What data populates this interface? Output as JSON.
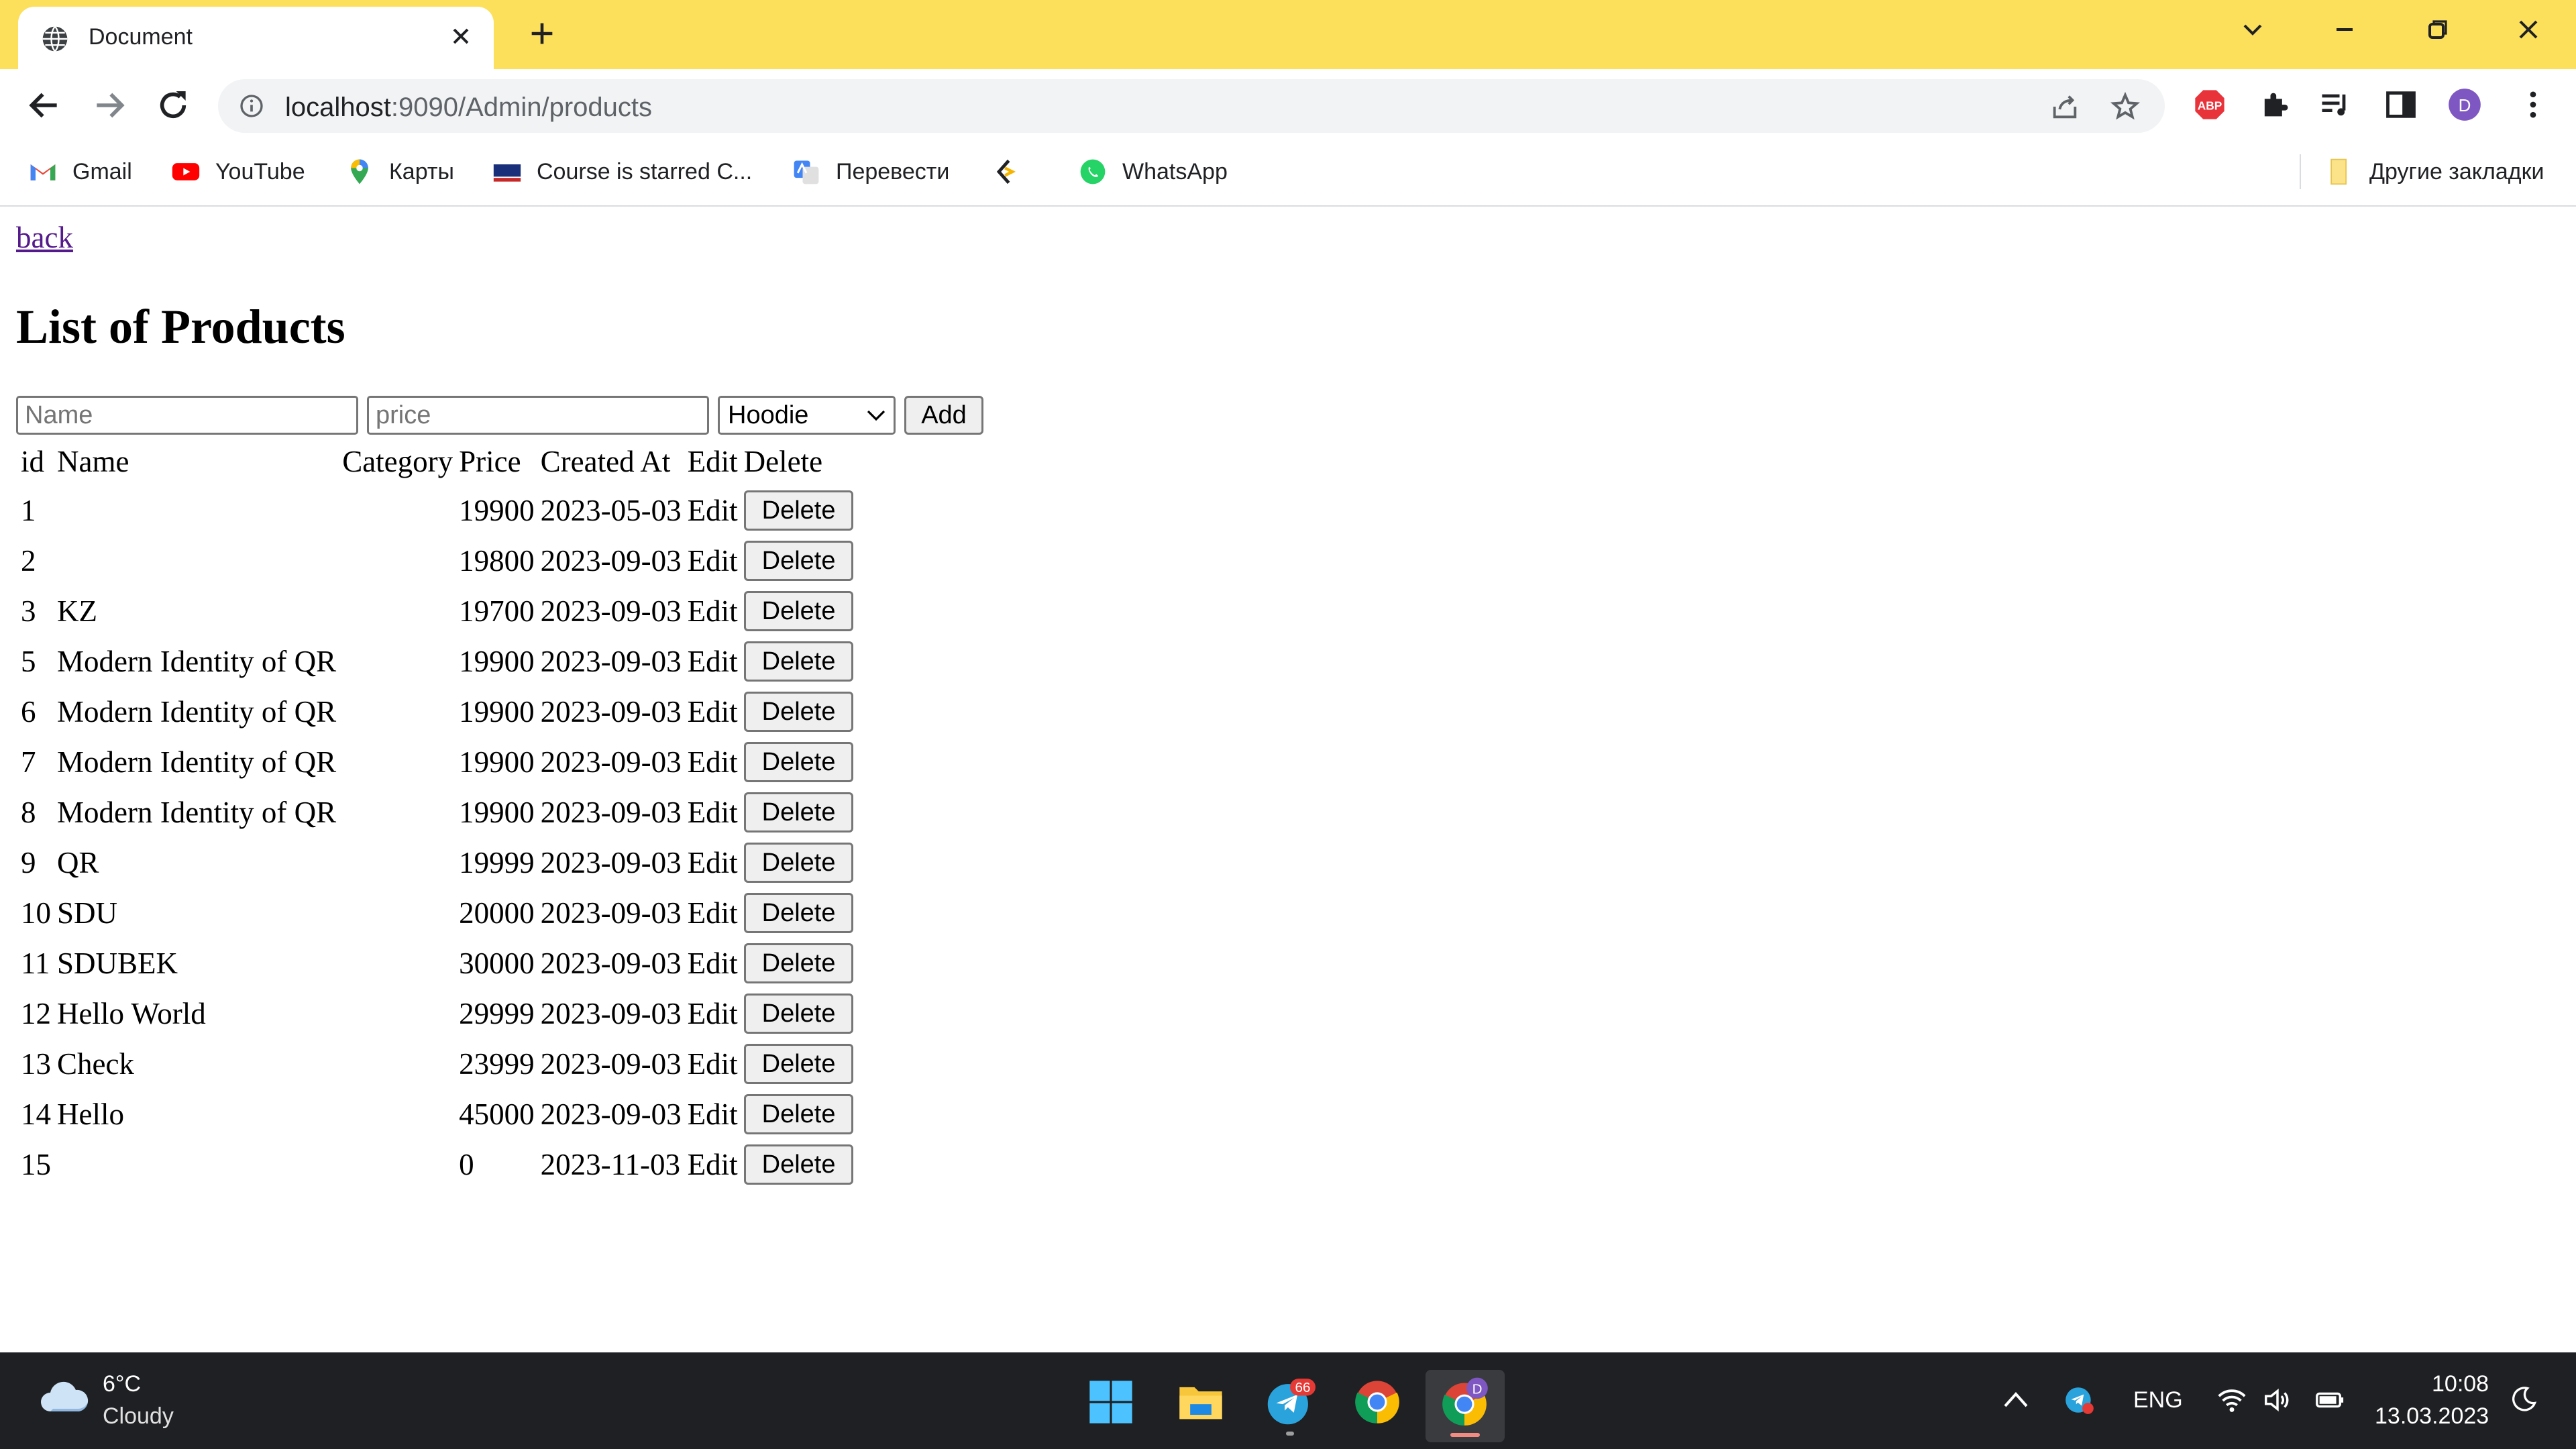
{
  "browser": {
    "tab_title": "Document",
    "url_host": "localhost",
    "url_rest": ":9090/Admin/products",
    "bookmarks": [
      "Gmail",
      "YouTube",
      "Карты",
      "Course is starred C...",
      "Перевести",
      "WhatsApp"
    ],
    "other_bookmarks": "Другие закладки",
    "profile_initial": "D",
    "abp_label": "ABP",
    "colors": {
      "tabstrip": "#fcdf5b",
      "profile": "#7e57c2",
      "abp": "#e8333a"
    }
  },
  "page": {
    "back_label": "back",
    "title": "List of Products",
    "form": {
      "name_placeholder": "Name",
      "price_placeholder": "price",
      "category_selected": "Hoodie",
      "add_label": "Add"
    },
    "table": {
      "headers": [
        "id",
        "Name",
        "Category",
        "Price",
        "Created At",
        "Edit",
        "Delete"
      ],
      "edit_label": "Edit",
      "delete_label": "Delete",
      "rows": [
        {
          "id": "1",
          "name": "",
          "category": "",
          "price": "19900",
          "created": "2023-05-03"
        },
        {
          "id": "2",
          "name": "",
          "category": "",
          "price": "19800",
          "created": "2023-09-03"
        },
        {
          "id": "3",
          "name": "KZ",
          "category": "",
          "price": "19700",
          "created": "2023-09-03"
        },
        {
          "id": "5",
          "name": "Modern Identity of QR",
          "category": "",
          "price": "19900",
          "created": "2023-09-03"
        },
        {
          "id": "6",
          "name": "Modern Identity of QR",
          "category": "",
          "price": "19900",
          "created": "2023-09-03"
        },
        {
          "id": "7",
          "name": "Modern Identity of QR",
          "category": "",
          "price": "19900",
          "created": "2023-09-03"
        },
        {
          "id": "8",
          "name": "Modern Identity of QR",
          "category": "",
          "price": "19900",
          "created": "2023-09-03"
        },
        {
          "id": "9",
          "name": "QR",
          "category": "",
          "price": "19999",
          "created": "2023-09-03"
        },
        {
          "id": "10",
          "name": "SDU",
          "category": "",
          "price": "20000",
          "created": "2023-09-03"
        },
        {
          "id": "11",
          "name": "SDUBEK",
          "category": "",
          "price": "30000",
          "created": "2023-09-03"
        },
        {
          "id": "12",
          "name": "Hello World",
          "category": "",
          "price": "29999",
          "created": "2023-09-03"
        },
        {
          "id": "13",
          "name": "Check",
          "category": "",
          "price": "23999",
          "created": "2023-09-03"
        },
        {
          "id": "14",
          "name": "Hello",
          "category": "",
          "price": "45000",
          "created": "2023-09-03"
        },
        {
          "id": "15",
          "name": "",
          "category": "",
          "price": "0",
          "created": "2023-11-03"
        }
      ]
    }
  },
  "taskbar": {
    "weather_temp": "6°C",
    "weather_condition": "Cloudy",
    "telegram_badge": "66",
    "chrome_profile_initial": "D",
    "language": "ENG",
    "time": "10:08",
    "date": "13.03.2023"
  }
}
